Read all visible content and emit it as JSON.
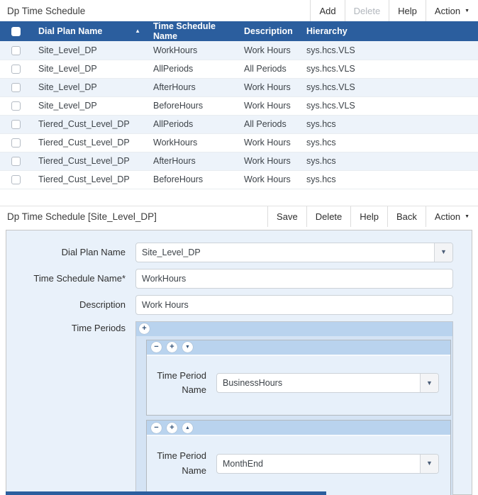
{
  "colors": {
    "header_blue": "#2b5e9e",
    "row_stripe": "#edf3fa",
    "panel_bg": "#e9f1fa",
    "section_bar": "#b9d3ee"
  },
  "icons": {
    "sort_ascending": "▲",
    "menu_caret": "▼",
    "select_arrow": "▼",
    "add": "+",
    "remove": "−",
    "move_down": "▼",
    "move_up": "▲"
  },
  "list_panel": {
    "title": "Dp Time Schedule",
    "toolbar": {
      "add": "Add",
      "delete": "Delete",
      "help": "Help",
      "action": "Action"
    },
    "table": {
      "columns": {
        "dial_plan": "Dial Plan Name",
        "schedule": "Time Schedule Name",
        "description": "Description",
        "hierarchy": "Hierarchy"
      },
      "sort": {
        "column": "Dial Plan Name",
        "direction": "ascending"
      },
      "rows": [
        {
          "dial_plan": "Site_Level_DP",
          "schedule": "WorkHours",
          "description": "Work Hours",
          "hierarchy": "sys.hcs.VLS"
        },
        {
          "dial_plan": "Site_Level_DP",
          "schedule": "AllPeriods",
          "description": "All Periods",
          "hierarchy": "sys.hcs.VLS"
        },
        {
          "dial_plan": "Site_Level_DP",
          "schedule": "AfterHours",
          "description": "Work Hours",
          "hierarchy": "sys.hcs.VLS"
        },
        {
          "dial_plan": "Site_Level_DP",
          "schedule": "BeforeHours",
          "description": "Work Hours",
          "hierarchy": "sys.hcs.VLS"
        },
        {
          "dial_plan": "Tiered_Cust_Level_DP",
          "schedule": "AllPeriods",
          "description": "All Periods",
          "hierarchy": "sys.hcs"
        },
        {
          "dial_plan": "Tiered_Cust_Level_DP",
          "schedule": "WorkHours",
          "description": "Work Hours",
          "hierarchy": "sys.hcs"
        },
        {
          "dial_plan": "Tiered_Cust_Level_DP",
          "schedule": "AfterHours",
          "description": "Work Hours",
          "hierarchy": "sys.hcs"
        },
        {
          "dial_plan": "Tiered_Cust_Level_DP",
          "schedule": "BeforeHours",
          "description": "Work Hours",
          "hierarchy": "sys.hcs"
        }
      ]
    }
  },
  "detail_panel": {
    "title": "Dp Time Schedule [Site_Level_DP]",
    "toolbar": {
      "save": "Save",
      "delete": "Delete",
      "help": "Help",
      "back": "Back",
      "action": "Action"
    },
    "form": {
      "dial_plan_name": {
        "label": "Dial Plan Name",
        "value": "Site_Level_DP"
      },
      "time_schedule_name": {
        "label": "Time Schedule Name*",
        "value": "WorkHours"
      },
      "description": {
        "label": "Description",
        "value": "Work Hours"
      },
      "time_periods": {
        "label": "Time Periods",
        "items": [
          {
            "label": "Time Period Name",
            "value": "BusinessHours"
          },
          {
            "label": "Time Period Name",
            "value": "MonthEnd"
          }
        ]
      }
    }
  }
}
